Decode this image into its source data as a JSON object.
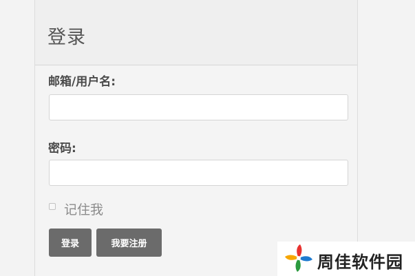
{
  "login": {
    "title": "登录",
    "username_label": "邮箱/用户名:",
    "username_value": "",
    "password_label": "密码:",
    "password_value": "",
    "remember_label": "记住我",
    "remember_checked": false,
    "login_button": "登录",
    "register_button": "我要注册"
  },
  "watermark": {
    "text": "周佳软件园",
    "logo_icon": "pinwheel-logo-icon",
    "colors": [
      "#e8312f",
      "#2b9a3e",
      "#f7a600",
      "#1f7bd0"
    ]
  }
}
